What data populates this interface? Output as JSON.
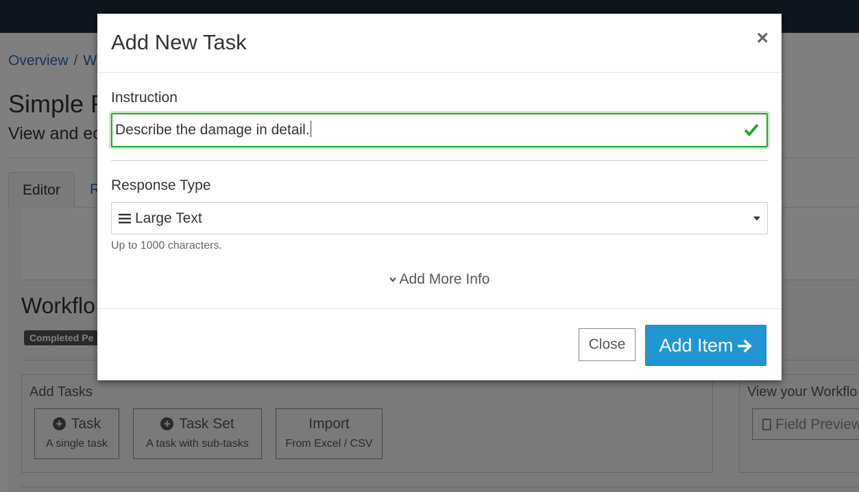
{
  "background": {
    "breadcrumb": {
      "item1": "Overview",
      "separator": "/",
      "item2": "W"
    },
    "page_title": "Simple F",
    "page_subtitle": "View and ec",
    "tabs": {
      "editor": "Editor",
      "second": "R"
    },
    "workflow_heading": "Workflo",
    "completed_badge": "Completed Pe",
    "add_tasks": {
      "title": "Add Tasks",
      "buttons": [
        {
          "label": "Task",
          "sub": "A single task",
          "icon": "plus-circle-icon"
        },
        {
          "label": "Task Set",
          "sub": "A task with sub-tasks",
          "icon": "plus-circle-icon"
        },
        {
          "label": "Import",
          "sub": "From Excel / CSV"
        }
      ]
    },
    "view_workflow": {
      "title": "View your Workflo",
      "field_preview": "Field Preview"
    }
  },
  "modal": {
    "title": "Add New Task",
    "close_symbol": "×",
    "instruction": {
      "label": "Instruction",
      "value": "Describe the damage in detail."
    },
    "response_type": {
      "label": "Response Type",
      "selected": "Large Text",
      "icon": "bars-icon",
      "help": "Up to 1000 characters."
    },
    "add_more_info": "Add More Info",
    "buttons": {
      "close": "Close",
      "add_item": "Add Item"
    }
  },
  "colors": {
    "accent": "#2196d3",
    "valid": "#2ca02c",
    "topbar": "#1f2d3d"
  }
}
